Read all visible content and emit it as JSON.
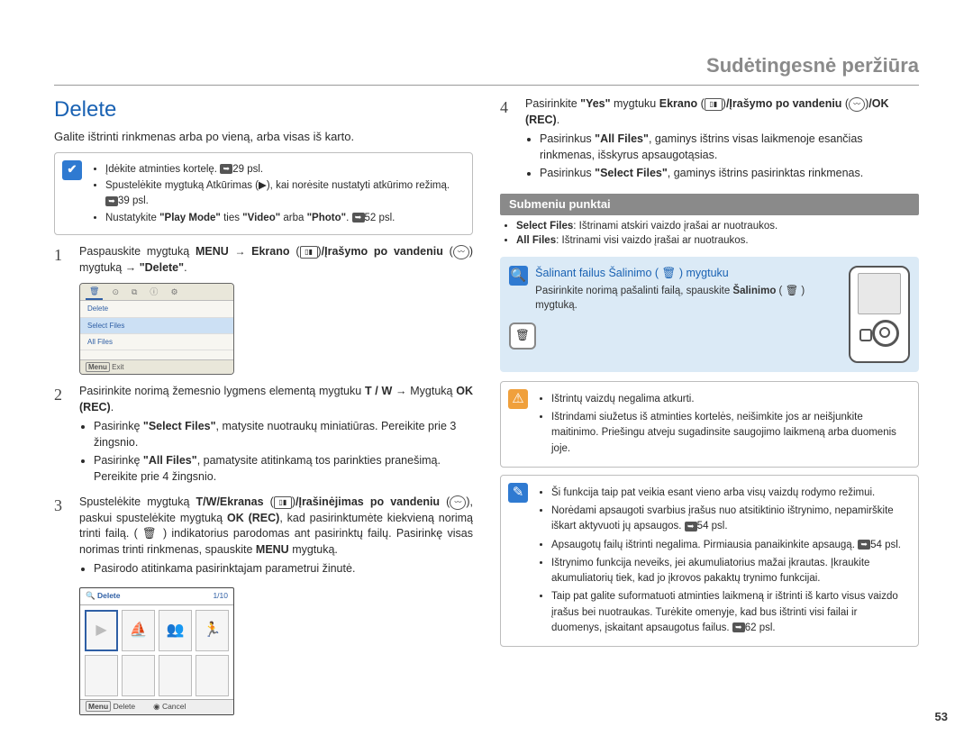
{
  "header": {
    "breadcrumb": "Sudėtingesnė peržiūra"
  },
  "section": {
    "title": "Delete",
    "intro": "Galite ištrinti rinkmenas arba po vieną, arba visas iš karto."
  },
  "prebox": {
    "items": [
      "Įdėkite atminties kortelę.",
      "Spustelėkite mygtuką Atkūrimas (▶), kai norėsite nustatyti atkūrimo režimą.",
      "Nustatykite \"Play Mode\" ties \"Video\" arba \"Photo\"."
    ],
    "refs": [
      "29 psl.",
      "39 psl.",
      "52 psl."
    ]
  },
  "steps_left": {
    "1": {
      "text_a": "Paspauskite mygtuką ",
      "menu": "MENU",
      "text_b": " → ",
      "label1": "Ekrano",
      "label2": "/Įrašymo po vandeniu",
      "text_c": " mygtuką → ",
      "delete": "\"Delete\"",
      "suffix": "."
    },
    "2": {
      "lead": "Pasirinkite norimą žemesnio lygmens elementą mygtuku ",
      "tw": "T / W",
      "arrow": " → Mygtuką ",
      "ok": "OK (REC)",
      "suffix": ".",
      "b1_a": "Pasirinkę ",
      "b1_bold": "\"Select Files\"",
      "b1_b": ", matysite nuotraukų miniatiūras. Pereikite prie 3 žingsnio.",
      "b2_a": "Pasirinkę ",
      "b2_bold": "\"All Files\"",
      "b2_b": ", pamatysite atitinkamą tos parinkties pranešimą. Pereikite prie 4 žingsnio."
    },
    "3": {
      "lead_a": "Spustelėkite mygtuką ",
      "bold1": "T/W/Ekranas",
      "mid": "/Įrašinėjimas po vandeniu",
      "lead_b": ", paskui spustelėkite mygtuką ",
      "bold2": "OK (REC)",
      "lead_c": ", kad pasirinktumėte kiekvieną norimą trinti failą. ( 🗑 ) indikatorius parodomas ant pasirinktų failų. Pasirinkę visas norimas trinti rinkmenas, spauskite ",
      "bold3": "MENU",
      "lead_d": " mygtuką.",
      "bullet": "Pasirodo atitinkama pasirinktajam parametrui žinutė."
    }
  },
  "screenshot1": {
    "row0": "Delete",
    "row1": "Select Files",
    "row2": "All Files",
    "foot_exit": "Exit",
    "foot_menu": "Menu"
  },
  "screenshot2": {
    "title": "Delete",
    "counter": "1/10",
    "foot_delete": "Delete",
    "foot_cancel": "Cancel",
    "foot_menu": "Menu"
  },
  "step4": {
    "lead_a": "Pasirinkite ",
    "yes": "\"Yes\"",
    "lead_b": " mygtuku ",
    "bold1": "Ekrano",
    "mid1": "/Įrašymo po vandeniu",
    "ok": "/OK (REC)",
    "suffix": ".",
    "b1_a": "Pasirinkus ",
    "b1_bold": "\"All Files\"",
    "b1_b": ", gaminys ištrins visas laikmenoje esančias rinkmenas, išskyrus apsaugotąsias.",
    "b2_a": "Pasirinkus ",
    "b2_bold": "\"Select Files\"",
    "b2_b": ", gaminys ištrins pasirinktas rinkmenas."
  },
  "submenu": {
    "heading": "Submeniu punktai",
    "i1_bold": "Select Files",
    "i1_rest": ": Ištrinami atskiri vaizdo įrašai ar nuotraukos.",
    "i2_bold": "All Files",
    "i2_rest": ": Ištrinami visi vaizdo įrašai ar nuotraukos."
  },
  "callout": {
    "title": "Šalinant failus Šalinimo ( 🗑 ) mygtuku",
    "body_a": "Pasirinkite norimą pašalinti failą, spauskite ",
    "body_bold": "Šalinimo",
    "body_b": " ( 🗑 ) mygtuką."
  },
  "warn_box": {
    "i1": "Ištrintų vaizdų negalima atkurti.",
    "i2": "Ištrindami siužetus iš atminties kortelės, neišimkite jos ar neišjunkite maitinimo. Priešingu atveju sugadinsite saugojimo laikmeną arba duomenis joje."
  },
  "note_box": {
    "i1": "Ši funkcija taip pat veikia esant vieno arba visų vaizdų rodymo režimui.",
    "i2_a": "Norėdami apsaugoti svarbius įrašus nuo atsitiktinio ištrynimo, nepamirškite iškart aktyvuoti jų apsaugos. ",
    "i2_ref": "54 psl.",
    "i3_a": "Apsaugotų failų ištrinti negalima. Pirmiausia panaikinkite apsaugą. ",
    "i3_ref": "54 psl.",
    "i4": "Ištrynimo funkcija neveiks, jei akumuliatorius mažai įkrautas. Įkraukite akumuliatorių tiek, kad jo įkrovos pakaktų trynimo funkcijai.",
    "i5_a": "Taip pat galite suformatuoti atminties laikmeną ir ištrinti iš karto visus vaizdo įrašus bei nuotraukas. Turėkite omenyje, kad bus ištrinti visi failai ir duomenys, įskaitant apsaugotus failus. ",
    "i5_ref": "62 psl."
  },
  "page_number": "53"
}
